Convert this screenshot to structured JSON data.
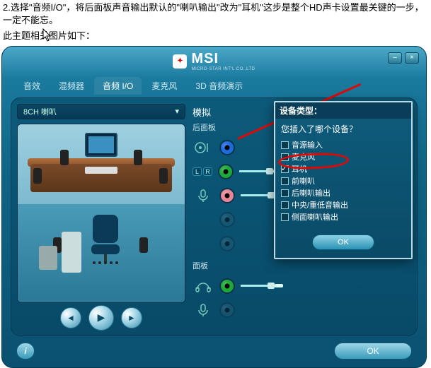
{
  "instructions": {
    "line1": "2.选择\"音频I/O\"，将后面板声音输出默认的\"喇叭输出\"改为\"耳机\"这步是整个HD声卡设置最关键的一步，一定不能忘。",
    "line2": "此主题相关图片如下："
  },
  "brand": {
    "name": "MSI",
    "sub": "MICRO-STAR INT'L CO.,LTD"
  },
  "tabs": [
    {
      "label": "音效"
    },
    {
      "label": "混频器"
    },
    {
      "label": "音频 I/O"
    },
    {
      "label": "麦克风"
    },
    {
      "label": "3D 音频演示"
    }
  ],
  "channel": {
    "label": "8CH 喇叭"
  },
  "sections": {
    "analog": "模拟",
    "rear": "后面板",
    "front": "面板"
  },
  "lr": {
    "l": "L",
    "r": "R"
  },
  "dialog": {
    "title": "设备类型：",
    "question": "您插入了哪个设备？",
    "items": [
      {
        "label": "音源输入",
        "checked": false
      },
      {
        "label": "麦克风",
        "checked": false
      },
      {
        "label": "耳机",
        "checked": true
      },
      {
        "label": "前喇叭",
        "checked": false
      },
      {
        "label": "后喇叭输出",
        "checked": false
      },
      {
        "label": "中央/重低音输出",
        "checked": false
      },
      {
        "label": "侧面喇叭输出",
        "checked": false
      }
    ],
    "ok": "OK"
  },
  "buttons": {
    "ok": "OK",
    "info": "i"
  },
  "play": {
    "prev": "◄",
    "play": "▶",
    "next": "►"
  }
}
